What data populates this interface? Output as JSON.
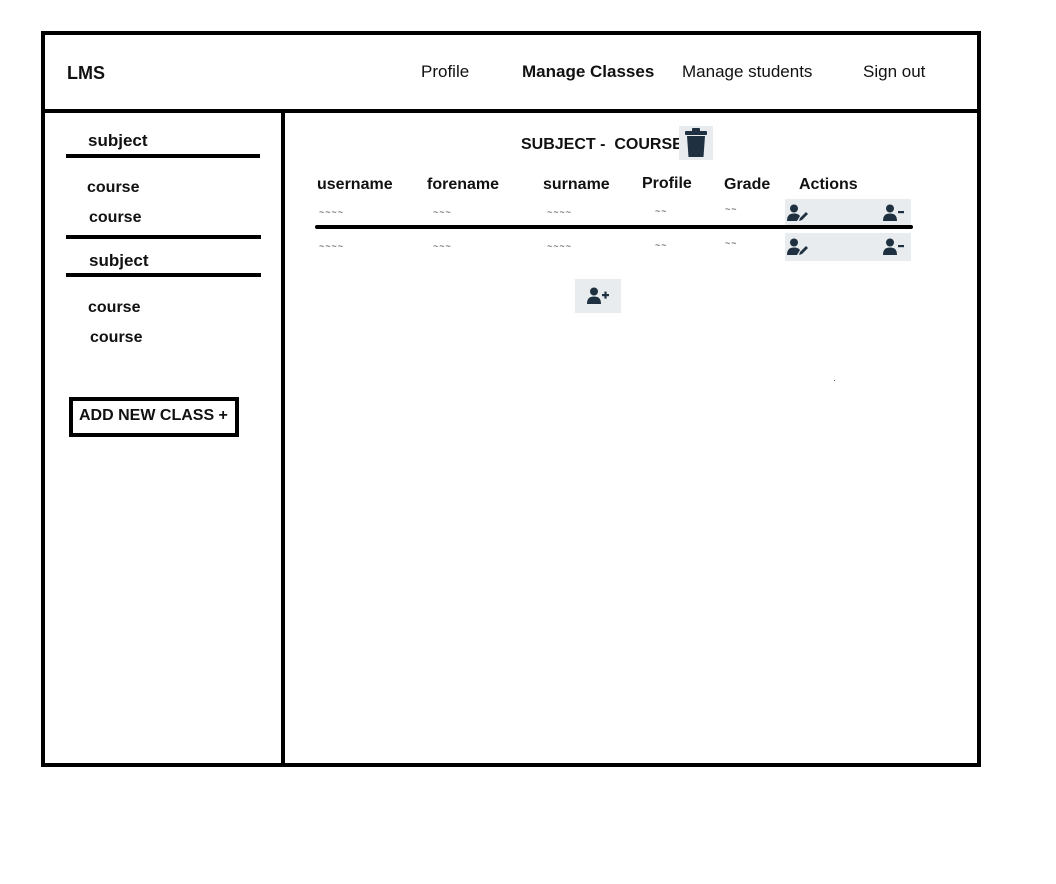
{
  "header": {
    "logo": "LMS",
    "nav": [
      {
        "label": "Profile"
      },
      {
        "label": "Manage Classes"
      },
      {
        "label": "Manage students"
      },
      {
        "label": "Sign out"
      }
    ]
  },
  "sidebar": {
    "groups": [
      {
        "subject": "subject",
        "courses": [
          "course",
          "course"
        ]
      },
      {
        "subject": "subject",
        "courses": [
          "course",
          "course"
        ]
      }
    ],
    "add_class_label": "ADD NEW CLASS +"
  },
  "main": {
    "title": "SUBJECT -  COURSE",
    "columns": [
      "username",
      "forename",
      "surname",
      "Profile",
      "Grade",
      "Actions"
    ],
    "rows": [
      {
        "username": "~~~~",
        "forename": "~~~",
        "surname": "~~~~",
        "profile": "~~",
        "grade": "~~"
      },
      {
        "username": "~~~~",
        "forename": "~~~",
        "surname": "~~~~",
        "profile": "~~",
        "grade": "~~"
      }
    ],
    "icons": {
      "delete": "trash-icon",
      "edit_user": "user-edit-icon",
      "remove_user": "user-minus-icon",
      "add_user": "user-plus-icon"
    },
    "icon_color": "#1f3140"
  }
}
